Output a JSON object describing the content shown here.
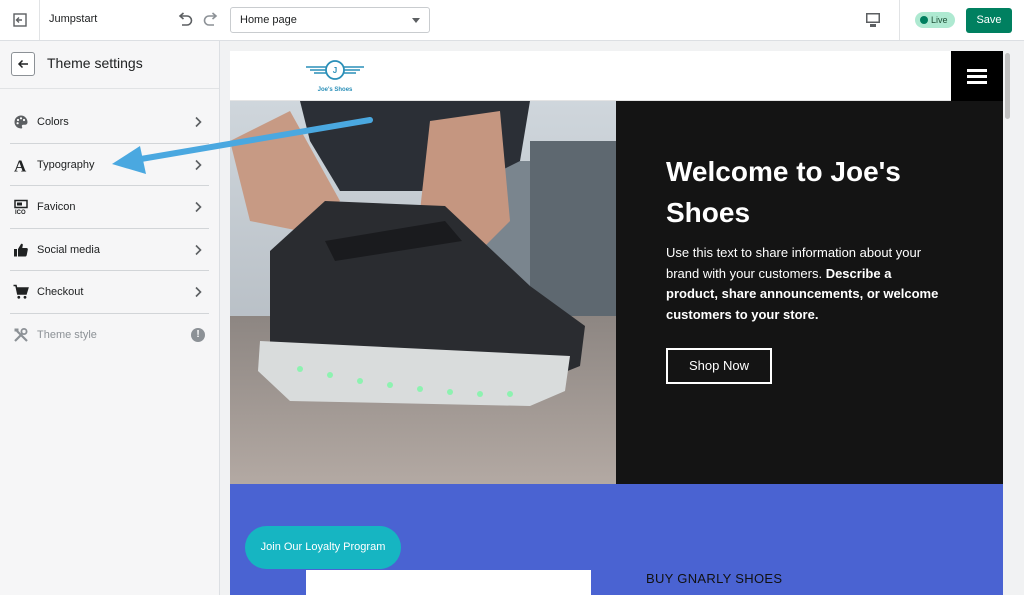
{
  "topbar": {
    "store_name": "Jumpstart",
    "page_select_value": "Home page",
    "live_label": "Live",
    "save_label": "Save"
  },
  "sidebar": {
    "title": "Theme settings",
    "items": [
      {
        "label": "Colors",
        "icon": "palette-icon"
      },
      {
        "label": "Typography",
        "icon": "typography-icon"
      },
      {
        "label": "Favicon",
        "icon": "favicon-icon"
      },
      {
        "label": "Social media",
        "icon": "thumbs-up-icon"
      },
      {
        "label": "Checkout",
        "icon": "cart-icon"
      },
      {
        "label": "Theme style",
        "icon": "tools-icon"
      }
    ],
    "theme_style_badge": "!"
  },
  "preview": {
    "logo_letter": "J",
    "logo_text": "Joe's Shoes",
    "hero_title": "Welcome to Joe's Shoes",
    "hero_body_plain": "Use this text to share information about your brand with your customers. ",
    "hero_body_bold": "Describe a product, share announcements, or welcome customers to your store.",
    "shop_button": "Shop Now",
    "loyalty_button": "Join Our Loyalty Program",
    "section_heading": "BUY GNARLY SHOES"
  },
  "colors": {
    "accent_green": "#008060",
    "annotation_arrow": "#4aa8e0",
    "hero_dark": "#141414",
    "band_blue": "#4a63d2",
    "loyalty_teal": "#16b5c2"
  }
}
